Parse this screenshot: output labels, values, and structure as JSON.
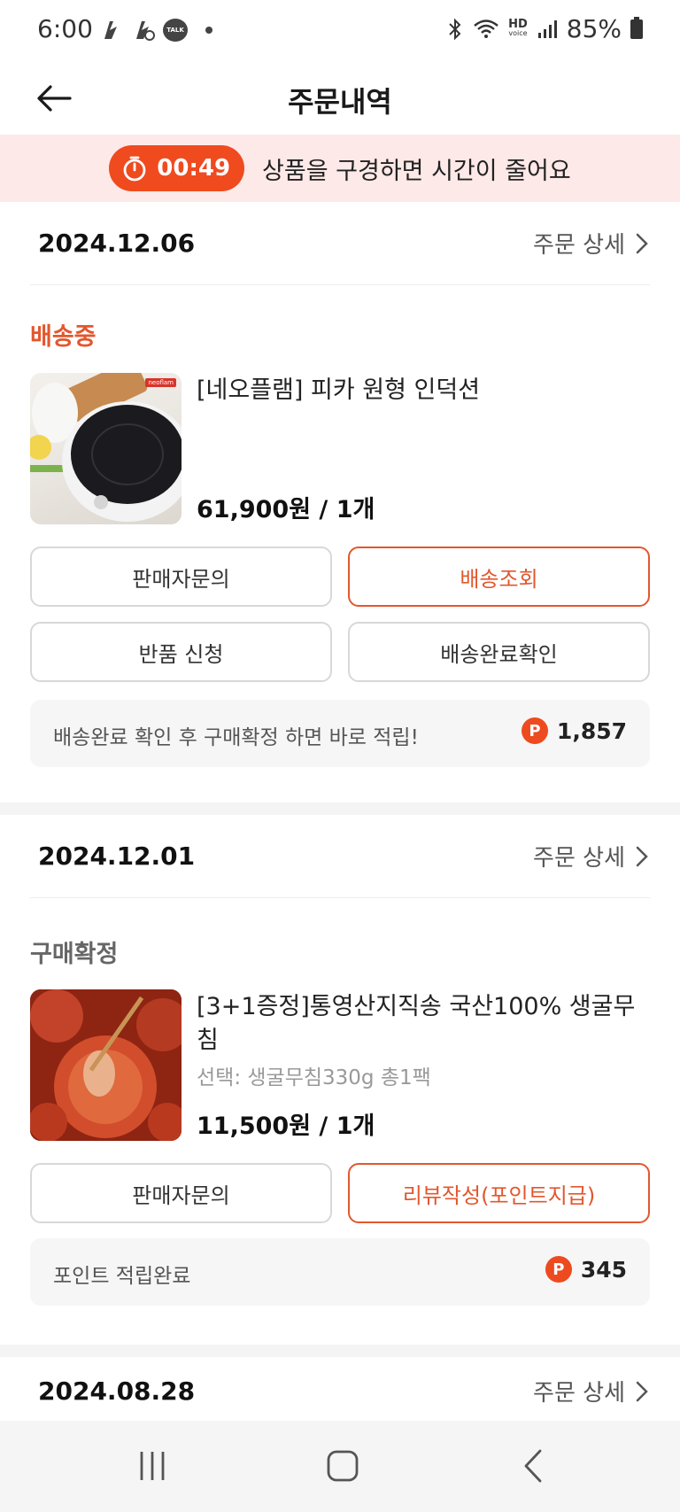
{
  "status_bar": {
    "time": "6:00",
    "talk_badge": "TALK",
    "hd_top": "HD",
    "hd_bottom": "voice",
    "battery": "85%"
  },
  "header": {
    "title": "주문내역"
  },
  "banner": {
    "timer": "00:49",
    "text": "상품을 구경하면 시간이 줄어요"
  },
  "orders": [
    {
      "date": "2024.12.06",
      "detail_label": "주문 상세",
      "status": "배송중",
      "status_color": "#e2572e",
      "product_name": "[네오플램] 피카 원형 인덕션",
      "thumb_brand": "neoflam",
      "price": "61,900원 / 1개",
      "buttons": [
        "판매자문의",
        "배송조회",
        "반품 신청",
        "배송완료확인"
      ],
      "point_text": "배송완료 확인 후 구매확정 하면 바로 적립!",
      "point_value": "1,857"
    },
    {
      "date": "2024.12.01",
      "detail_label": "주문 상세",
      "status": "구매확정",
      "status_color": "#666666",
      "product_name": "[3+1증정]통영산지직송 국산100% 생굴무침",
      "option": "선택: 생굴무침330g 총1팩",
      "price": "11,500원 / 1개",
      "buttons": [
        "판매자문의",
        "리뷰작성(포인트지급)"
      ],
      "point_text": "포인트 적립완료",
      "point_value": "345"
    },
    {
      "date": "2024.08.28",
      "detail_label": "주문 상세"
    }
  ],
  "point_badge": "P",
  "colors": {
    "accent": "#e2572e",
    "timer_bg": "#f04a1f",
    "banner_bg": "#fde9e7"
  },
  "icons": {
    "back": "back-arrow-icon",
    "chevron": "chevron-right-icon",
    "timer": "stopwatch-icon",
    "nav_recent": "recent-apps-icon",
    "nav_home": "home-icon",
    "nav_back": "nav-back-icon"
  }
}
